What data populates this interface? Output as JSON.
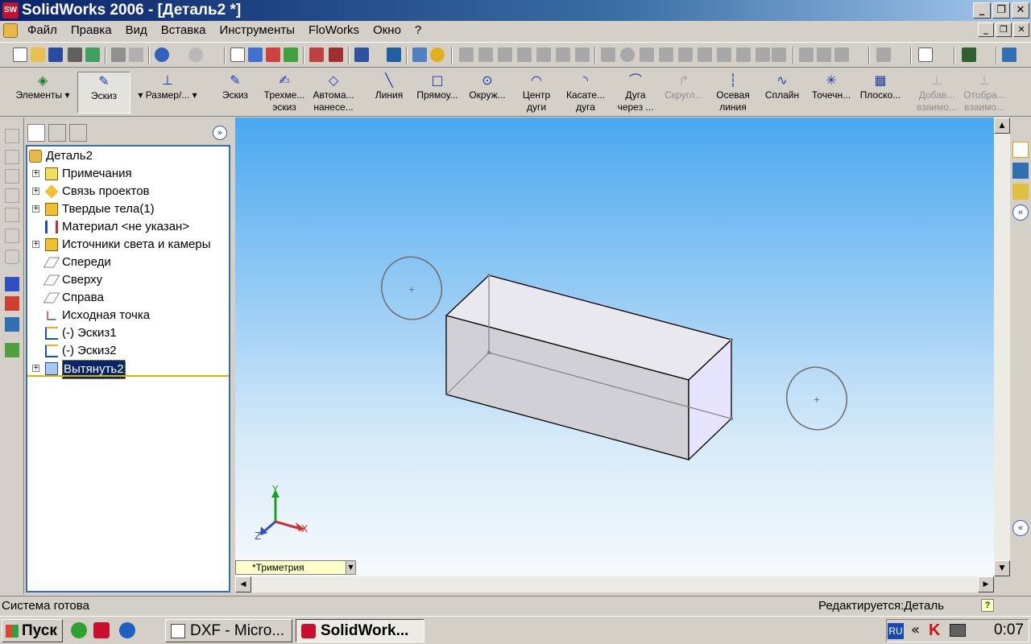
{
  "window": {
    "title": "SolidWorks 2006 - [Деталь2 *]",
    "app_icon_text": "SW"
  },
  "menu": {
    "items": [
      "Файл",
      "Правка",
      "Вид",
      "Вставка",
      "Инструменты",
      "FloWorks",
      "Окно",
      "?"
    ]
  },
  "command_manager": {
    "groups": [
      {
        "label": "Элементы"
      },
      {
        "label": "Эскиз"
      },
      {
        "label": "Размер/..."
      }
    ],
    "tools": [
      {
        "label": "Эскиз",
        "icon": "sketch-icon"
      },
      {
        "label": "Трехме... эскиз",
        "icon": "3d-sketch-icon"
      },
      {
        "label": "Автома... нанесе...",
        "icon": "auto-dimension-icon"
      },
      {
        "label": "Линия",
        "icon": "line-icon"
      },
      {
        "label": "Прямоу...",
        "icon": "rectangle-icon"
      },
      {
        "label": "Окруж...",
        "icon": "circle-icon"
      },
      {
        "label": "Центр дуги",
        "icon": "center-arc-icon"
      },
      {
        "label": "Касате... дуга",
        "icon": "tangent-arc-icon"
      },
      {
        "label": "Дуга через ...",
        "icon": "three-point-arc-icon"
      },
      {
        "label": "Скругл...",
        "icon": "fillet-icon"
      },
      {
        "label": "Осевая линия",
        "icon": "centerline-icon"
      },
      {
        "label": "Сплайн",
        "icon": "spline-icon"
      },
      {
        "label": "Точечн...",
        "icon": "point-icon"
      },
      {
        "label": "Плоско...",
        "icon": "plane-icon"
      },
      {
        "label": "Добав... взаимо...",
        "icon": "add-relation-icon"
      },
      {
        "label": "Отобра... взаимо...",
        "icon": "display-relations-icon"
      }
    ]
  },
  "feature_tree": {
    "root": "Деталь2",
    "items": [
      {
        "label": "Примечания",
        "expandable": true,
        "icon": "annotations-icon"
      },
      {
        "label": "Связь проектов",
        "expandable": true,
        "icon": "design-binder-icon"
      },
      {
        "label": "Твердые тела(1)",
        "expandable": true,
        "icon": "solid-bodies-icon"
      },
      {
        "label": "Материал <не указан>",
        "expandable": false,
        "icon": "material-icon"
      },
      {
        "label": "Источники света и камеры",
        "expandable": true,
        "icon": "lights-cameras-icon"
      },
      {
        "label": "Спереди",
        "expandable": false,
        "icon": "plane-icon"
      },
      {
        "label": "Сверху",
        "expandable": false,
        "icon": "plane-icon"
      },
      {
        "label": "Справа",
        "expandable": false,
        "icon": "plane-icon"
      },
      {
        "label": "Исходная точка",
        "expandable": false,
        "icon": "origin-icon"
      },
      {
        "label": "(-) Эскиз1",
        "expandable": false,
        "icon": "sketch-icon"
      },
      {
        "label": "(-) Эскиз2",
        "expandable": false,
        "icon": "sketch-icon"
      },
      {
        "label": "Вытянуть2",
        "expandable": true,
        "icon": "extrude-icon",
        "selected": true
      }
    ]
  },
  "viewport": {
    "view_orientation": "*Триметрия",
    "triad": {
      "x": "X",
      "y": "Y",
      "z": "Z"
    }
  },
  "status": {
    "text": "Система готова",
    "mode": "Редактируется:Деталь"
  },
  "taskbar": {
    "start_label": "Пуск",
    "tasks": [
      {
        "label": "DXF - Micro...",
        "active": false
      },
      {
        "label": "SolidWork...",
        "active": true
      }
    ],
    "tray_lang": "RU",
    "clock": "0:07"
  }
}
